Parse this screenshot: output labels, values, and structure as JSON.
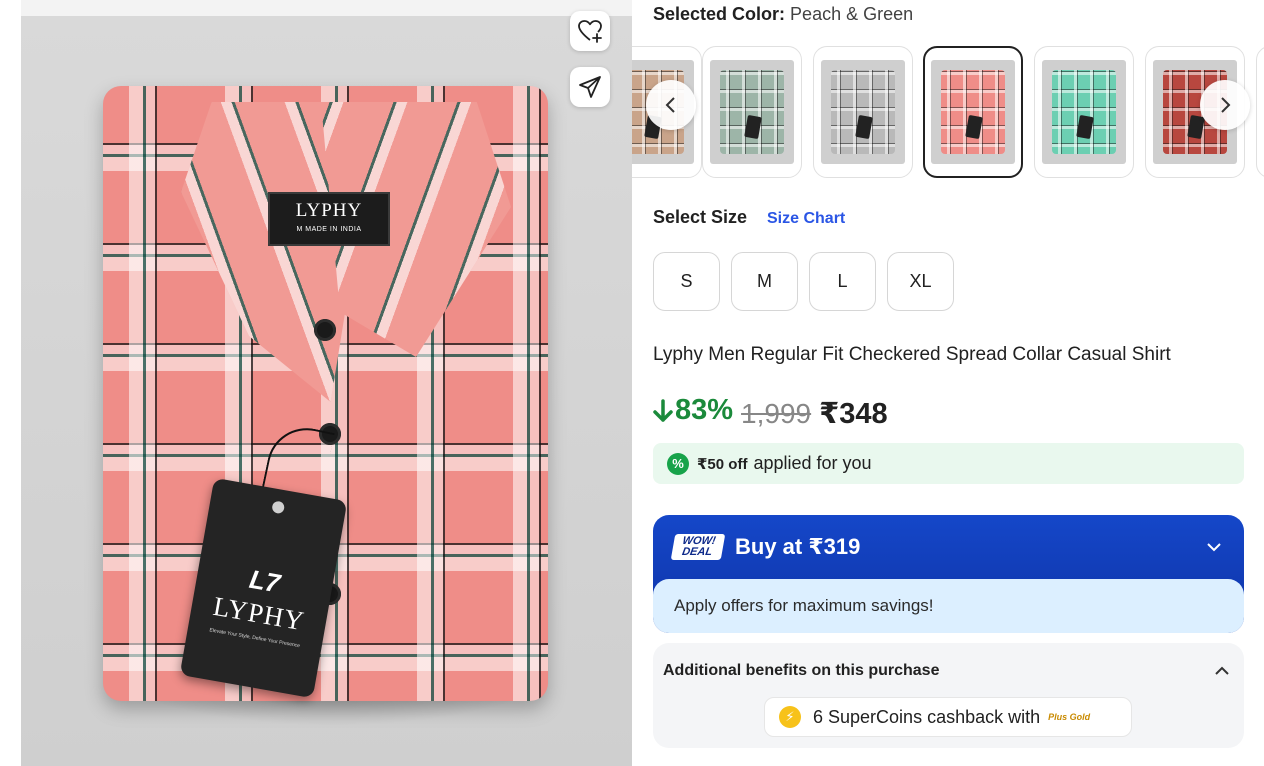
{
  "product_image": {
    "neck_label_brand": "LYPHY",
    "neck_label_size": "M",
    "neck_label_made": "MADE IN INDIA",
    "tag_logo": "L7",
    "tag_brand": "LYPHY",
    "tag_tagline": "Elevate Your Style, Define Your Presence"
  },
  "actions": {
    "wishlist_icon": "heart-plus-icon",
    "share_icon": "send-icon"
  },
  "color_picker": {
    "label": "Selected Color:",
    "value": "Peach & Green",
    "swatches": [
      {
        "name": "beige-check",
        "color": "#c9a48a"
      },
      {
        "name": "sage-check",
        "color": "#9db5a8"
      },
      {
        "name": "grey-check",
        "color": "#b9b9b9"
      },
      {
        "name": "peach-green-check",
        "color": "#ef8d88",
        "selected": true
      },
      {
        "name": "mint-check",
        "color": "#6ccfb2"
      },
      {
        "name": "red-check",
        "color": "#b8473f"
      }
    ]
  },
  "size_picker": {
    "label": "Select Size",
    "chart_link": "Size Chart",
    "sizes": [
      "S",
      "M",
      "L",
      "XL"
    ]
  },
  "product": {
    "title": "Lyphy Men Regular Fit Checkered Spread Collar Casual Shirt",
    "discount": "83%",
    "mrp": "1,999",
    "price": "₹348"
  },
  "coupon": {
    "amount": "₹50 off",
    "text": "applied for you"
  },
  "wow_deal": {
    "badge_line1": "WOW!",
    "badge_line2": "DEAL",
    "title": "Buy at ₹319",
    "subtitle": "Apply offers for maximum savings!"
  },
  "benefits": {
    "title": "Additional benefits on this purchase",
    "coins_text": "6 SuperCoins cashback with",
    "plus_gold": "Plus Gold"
  },
  "colors": {
    "green": "#1b8a3b",
    "link_blue": "#2a55e5",
    "deal_blue": "#1547c9",
    "coupon_bg": "#e9f8ee"
  }
}
